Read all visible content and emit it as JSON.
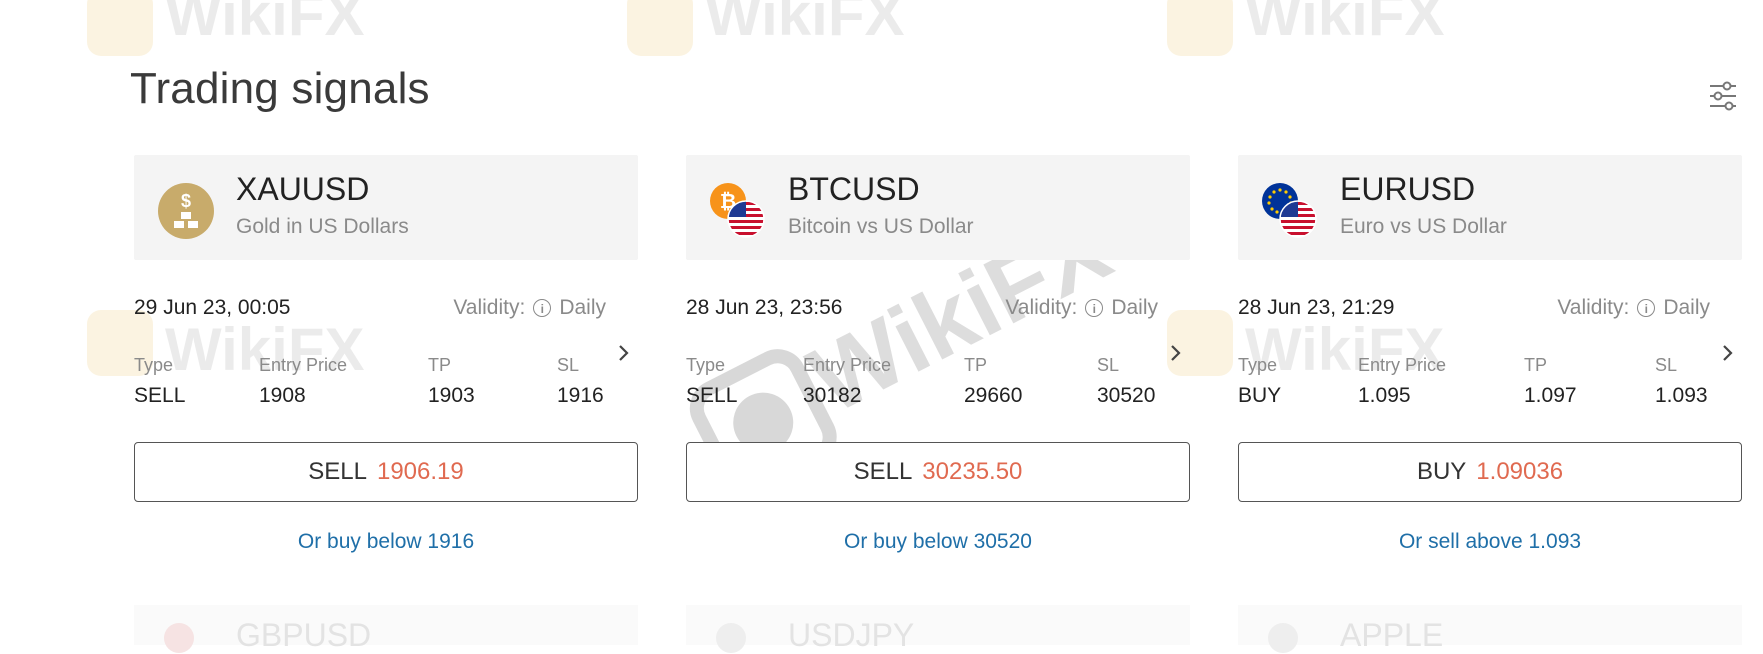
{
  "page": {
    "title": "Trading signals"
  },
  "labels": {
    "validity": "Validity:"
  },
  "watermark": "WikiFX",
  "signals": [
    {
      "symbol": "XAUUSD",
      "name": "Gold in US Dollars",
      "date": "29 Jun 23, 00:05",
      "validity": "Daily",
      "type_label": "Type",
      "type": "SELL",
      "entry_label": "Entry Price",
      "entry": "1908",
      "tp_label": "TP",
      "tp": "1903",
      "sl_label": "SL",
      "sl": "1916",
      "action_side": "SELL",
      "action_price": "1906.19",
      "alt": "Or buy below 1916",
      "icon": "gold-bars-icon"
    },
    {
      "symbol": "BTCUSD",
      "name": "Bitcoin vs US Dollar",
      "date": "28 Jun 23, 23:56",
      "validity": "Daily",
      "type_label": "Type",
      "type": "SELL",
      "entry_label": "Entry Price",
      "entry": "30182",
      "tp_label": "TP",
      "tp": "29660",
      "sl_label": "SL",
      "sl": "30520",
      "action_side": "SELL",
      "action_price": "30235.50",
      "alt": "Or buy below 30520",
      "icon": "bitcoin-usd-flag-icon"
    },
    {
      "symbol": "EURUSD",
      "name": "Euro vs US Dollar",
      "date": "28 Jun 23, 21:29",
      "validity": "Daily",
      "type_label": "Type",
      "type": "BUY",
      "entry_label": "Entry Price",
      "entry": "1.095",
      "tp_label": "TP",
      "tp": "1.097",
      "sl_label": "SL",
      "sl": "1.093",
      "action_side": "BUY",
      "action_price": "1.09036",
      "alt": "Or sell above 1.093",
      "icon": "eu-us-flag-icon"
    }
  ],
  "next_row": [
    "GBPUSD",
    "USDJPY",
    "APPLE"
  ],
  "colors": {
    "price": "#e06a50",
    "link": "#1f6fa8",
    "gold": "#c8ab6b",
    "bitcoin": "#f7931a",
    "eu_blue": "#003399"
  }
}
